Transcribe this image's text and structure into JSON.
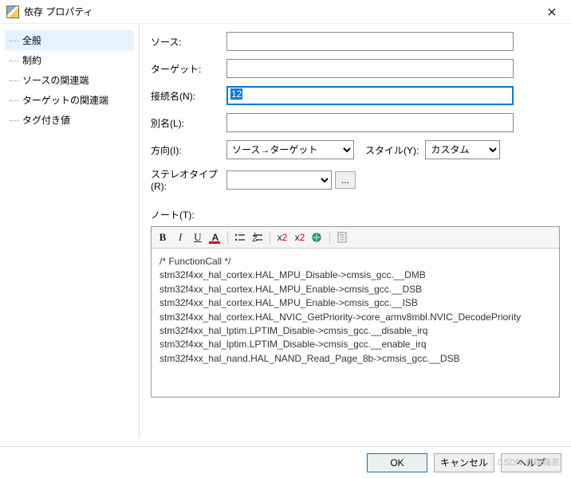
{
  "window": {
    "title": "依存 プロパティ"
  },
  "sidebar": {
    "items": [
      {
        "label": "全般",
        "selected": true
      },
      {
        "label": "制約"
      },
      {
        "label": "ソースの関連端"
      },
      {
        "label": "ターゲットの関連端"
      },
      {
        "label": "タグ付き値"
      }
    ]
  },
  "form": {
    "source_label": "ソース:",
    "source_value": "",
    "target_label": "ターゲット:",
    "target_value": "",
    "name_label": "接続名(N):",
    "name_value": "12",
    "alias_label": "別名(L):",
    "alias_value": "",
    "direction_label": "方向(I):",
    "direction_value": "ソース→ターゲット",
    "style_label": "スタイル(Y):",
    "style_value": "カスタム",
    "stereotype_label": "ステレオタイプ (R):",
    "stereotype_value": "",
    "ellipsis": "...",
    "note_label": "ノート(T):"
  },
  "toolbar": {
    "bold": "B",
    "italic": "I",
    "underline": "U",
    "font_color": "A",
    "superscript": "x",
    "super_exp": "2",
    "subscript": "x",
    "sub_exp": "2"
  },
  "note_lines": [
    "/* FunctionCall */",
    "stm32f4xx_hal_cortex.HAL_MPU_Disable->cmsis_gcc.__DMB",
    "stm32f4xx_hal_cortex.HAL_MPU_Enable->cmsis_gcc.__DSB",
    "stm32f4xx_hal_cortex.HAL_MPU_Enable->cmsis_gcc.__ISB",
    "stm32f4xx_hal_cortex.HAL_NVIC_GetPriority->core_armv8mbl.NVIC_DecodePriority",
    "stm32f4xx_hal_lptim.LPTIM_Disable->cmsis_gcc.__disable_irq",
    "stm32f4xx_hal_lptim.LPTIM_Disable->cmsis_gcc.__enable_irq",
    "stm32f4xx_hal_nand.HAL_NAND_Read_Page_8b->cmsis_gcc.__DSB"
  ],
  "footer": {
    "ok": "OK",
    "cancel": "キャンセル",
    "help": "ヘルプ"
  },
  "watermark": "CSDN @嗨嗨茶"
}
